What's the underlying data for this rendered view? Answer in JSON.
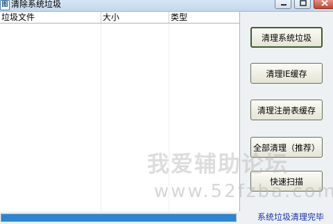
{
  "window": {
    "title": "清除系统垃圾",
    "app_icon_glyph": "图",
    "icons": [
      "app-icon",
      "minimize-icon",
      "maximize-icon",
      "close-icon"
    ]
  },
  "list": {
    "columns": [
      "垃圾文件",
      "大小",
      "类型"
    ],
    "rows": []
  },
  "buttons": {
    "clean_system": "清理系统垃圾",
    "clean_ie": "清理IE缓存",
    "clean_registry": "清理注册表缓存",
    "clean_all": "全部清理（推荐）",
    "quick_scan": "快速扫描"
  },
  "watermark": {
    "text": "我爱辅助论坛",
    "url": "www.52fzba.com"
  },
  "status": {
    "progress": 1.0,
    "text": "系统垃圾清理完毕"
  },
  "colors": {
    "progress_fill": "#2b85d6",
    "status_text": "#1c2fb0"
  }
}
